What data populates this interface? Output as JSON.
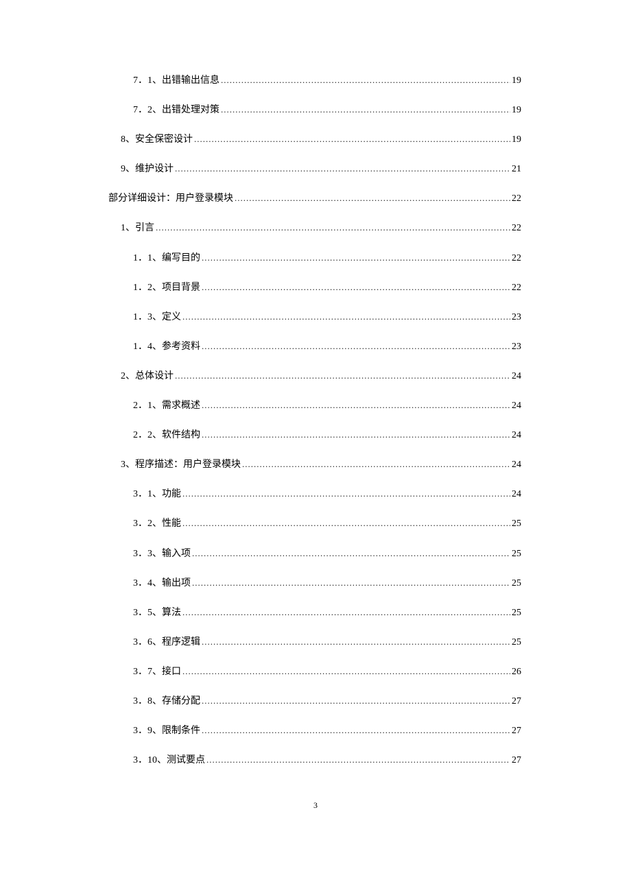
{
  "toc_entries": [
    {
      "indent": 2,
      "title": "7．1、出错输出信息",
      "page": "19"
    },
    {
      "indent": 2,
      "title": "7．2、出错处理对策",
      "page": "19"
    },
    {
      "indent": 1,
      "title": "8、安全保密设计",
      "page": "19"
    },
    {
      "indent": 1,
      "title": "9、维护设计",
      "page": "21"
    },
    {
      "indent": 0,
      "title": "部分详细设计：用户登录模块",
      "page": "22"
    },
    {
      "indent": 1,
      "title": "1、引言",
      "page": "22"
    },
    {
      "indent": 2,
      "title": "1．1、编写目的",
      "page": "22"
    },
    {
      "indent": 2,
      "title": "1．2、项目背景",
      "page": "22"
    },
    {
      "indent": 2,
      "title": "1．3、定义",
      "page": "23"
    },
    {
      "indent": 2,
      "title": "1．4、参考资料",
      "page": "23"
    },
    {
      "indent": 1,
      "title": "2、总体设计",
      "page": "24"
    },
    {
      "indent": 2,
      "title": "2．1、需求概述",
      "page": "24"
    },
    {
      "indent": 2,
      "title": "2．2、软件结构",
      "page": "24"
    },
    {
      "indent": 1,
      "title": "3、程序描述：用户登录模块",
      "page": "24"
    },
    {
      "indent": 2,
      "title": "3．1、功能",
      "page": "24"
    },
    {
      "indent": 2,
      "title": "3．2、性能",
      "page": "25"
    },
    {
      "indent": 2,
      "title": "3．3、输入项",
      "page": "25"
    },
    {
      "indent": 2,
      "title": "3．4、输出项",
      "page": "25"
    },
    {
      "indent": 2,
      "title": "3．5、算法",
      "page": "25"
    },
    {
      "indent": 2,
      "title": "3．6、程序逻辑",
      "page": "25"
    },
    {
      "indent": 2,
      "title": "3．7、接口",
      "page": "26"
    },
    {
      "indent": 2,
      "title": "3．8、存储分配",
      "page": "27"
    },
    {
      "indent": 2,
      "title": "3．9、限制条件",
      "page": "27"
    },
    {
      "indent": 2,
      "title": "3．10、测试要点",
      "page": "27"
    }
  ],
  "page_number": "3",
  "dots": "......................................................................................................................................................................................................."
}
